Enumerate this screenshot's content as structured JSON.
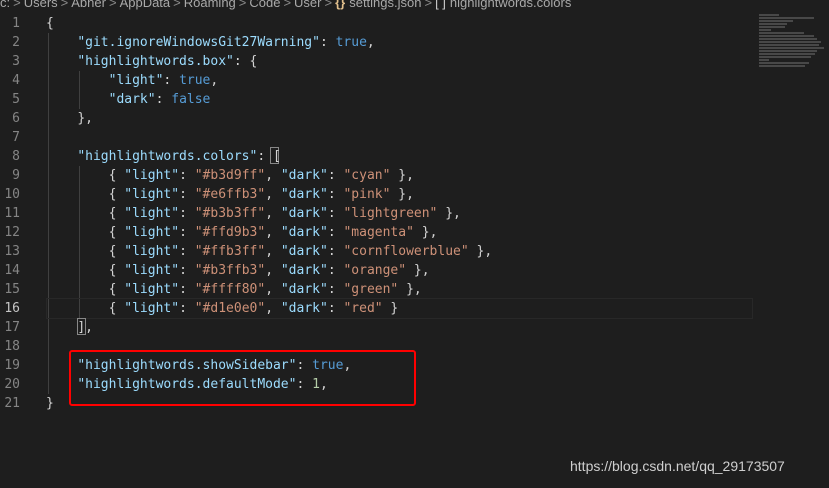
{
  "breadcrumb": {
    "items": [
      "c:",
      "Users",
      "Abner",
      "AppData",
      "Roaming",
      "Code",
      "User",
      "settings.json",
      "highlightwords.colors"
    ],
    "separator": ">",
    "file_icon": "{}",
    "symbol_icon": "[ ]"
  },
  "gutter": {
    "line_numbers": [
      "1",
      "2",
      "3",
      "4",
      "5",
      "6",
      "7",
      "8",
      "9",
      "10",
      "11",
      "12",
      "13",
      "14",
      "15",
      "16",
      "17",
      "18",
      "19",
      "20",
      "21"
    ],
    "active_line": "16"
  },
  "code": {
    "l1_open": "{",
    "l2_key": "\"git.ignoreWindowsGit27Warning\"",
    "l2_val": "true",
    "l3_key": "\"highlightwords.box\"",
    "l3_brace": "{",
    "l4_key": "\"light\"",
    "l4_val": "true",
    "l5_key": "\"dark\"",
    "l5_val": "false",
    "l6_close": "},",
    "l8_key": "\"highlightwords.colors\"",
    "l8_bracket": "[",
    "colors": [
      {
        "light": "\"#b3d9ff\"",
        "dark": "\"cyan\"",
        "end": " },"
      },
      {
        "light": "\"#e6ffb3\"",
        "dark": "\"pink\"",
        "end": " },"
      },
      {
        "light": "\"#b3b3ff\"",
        "dark": "\"lightgreen\"",
        "end": " },"
      },
      {
        "light": "\"#ffd9b3\"",
        "dark": "\"magenta\"",
        "end": " },"
      },
      {
        "light": "\"#ffb3ff\"",
        "dark": "\"cornflowerblue\"",
        "end": " },"
      },
      {
        "light": "\"#b3ffb3\"",
        "dark": "\"orange\"",
        "end": " },"
      },
      {
        "light": "\"#ffff80\"",
        "dark": "\"green\"",
        "end": " },"
      },
      {
        "light": "\"#d1e0e0\"",
        "dark": "\"red\"",
        "end": " }"
      }
    ],
    "light_key": "\"light\"",
    "dark_key": "\"dark\"",
    "l17_close": "],",
    "l19_key": "\"highlightwords.showSidebar\"",
    "l19_val": "true",
    "l20_key": "\"highlightwords.defaultMode\"",
    "l20_val": "1",
    "l21_close": "}"
  },
  "watermark": "https://blog.csdn.net/qq_29173507",
  "colors": {
    "background": "#1e1e1e",
    "key": "#9cdcfe",
    "string": "#ce9178",
    "boolean": "#569cd6",
    "number": "#b5cea8",
    "highlight_box": "#ff0000"
  }
}
